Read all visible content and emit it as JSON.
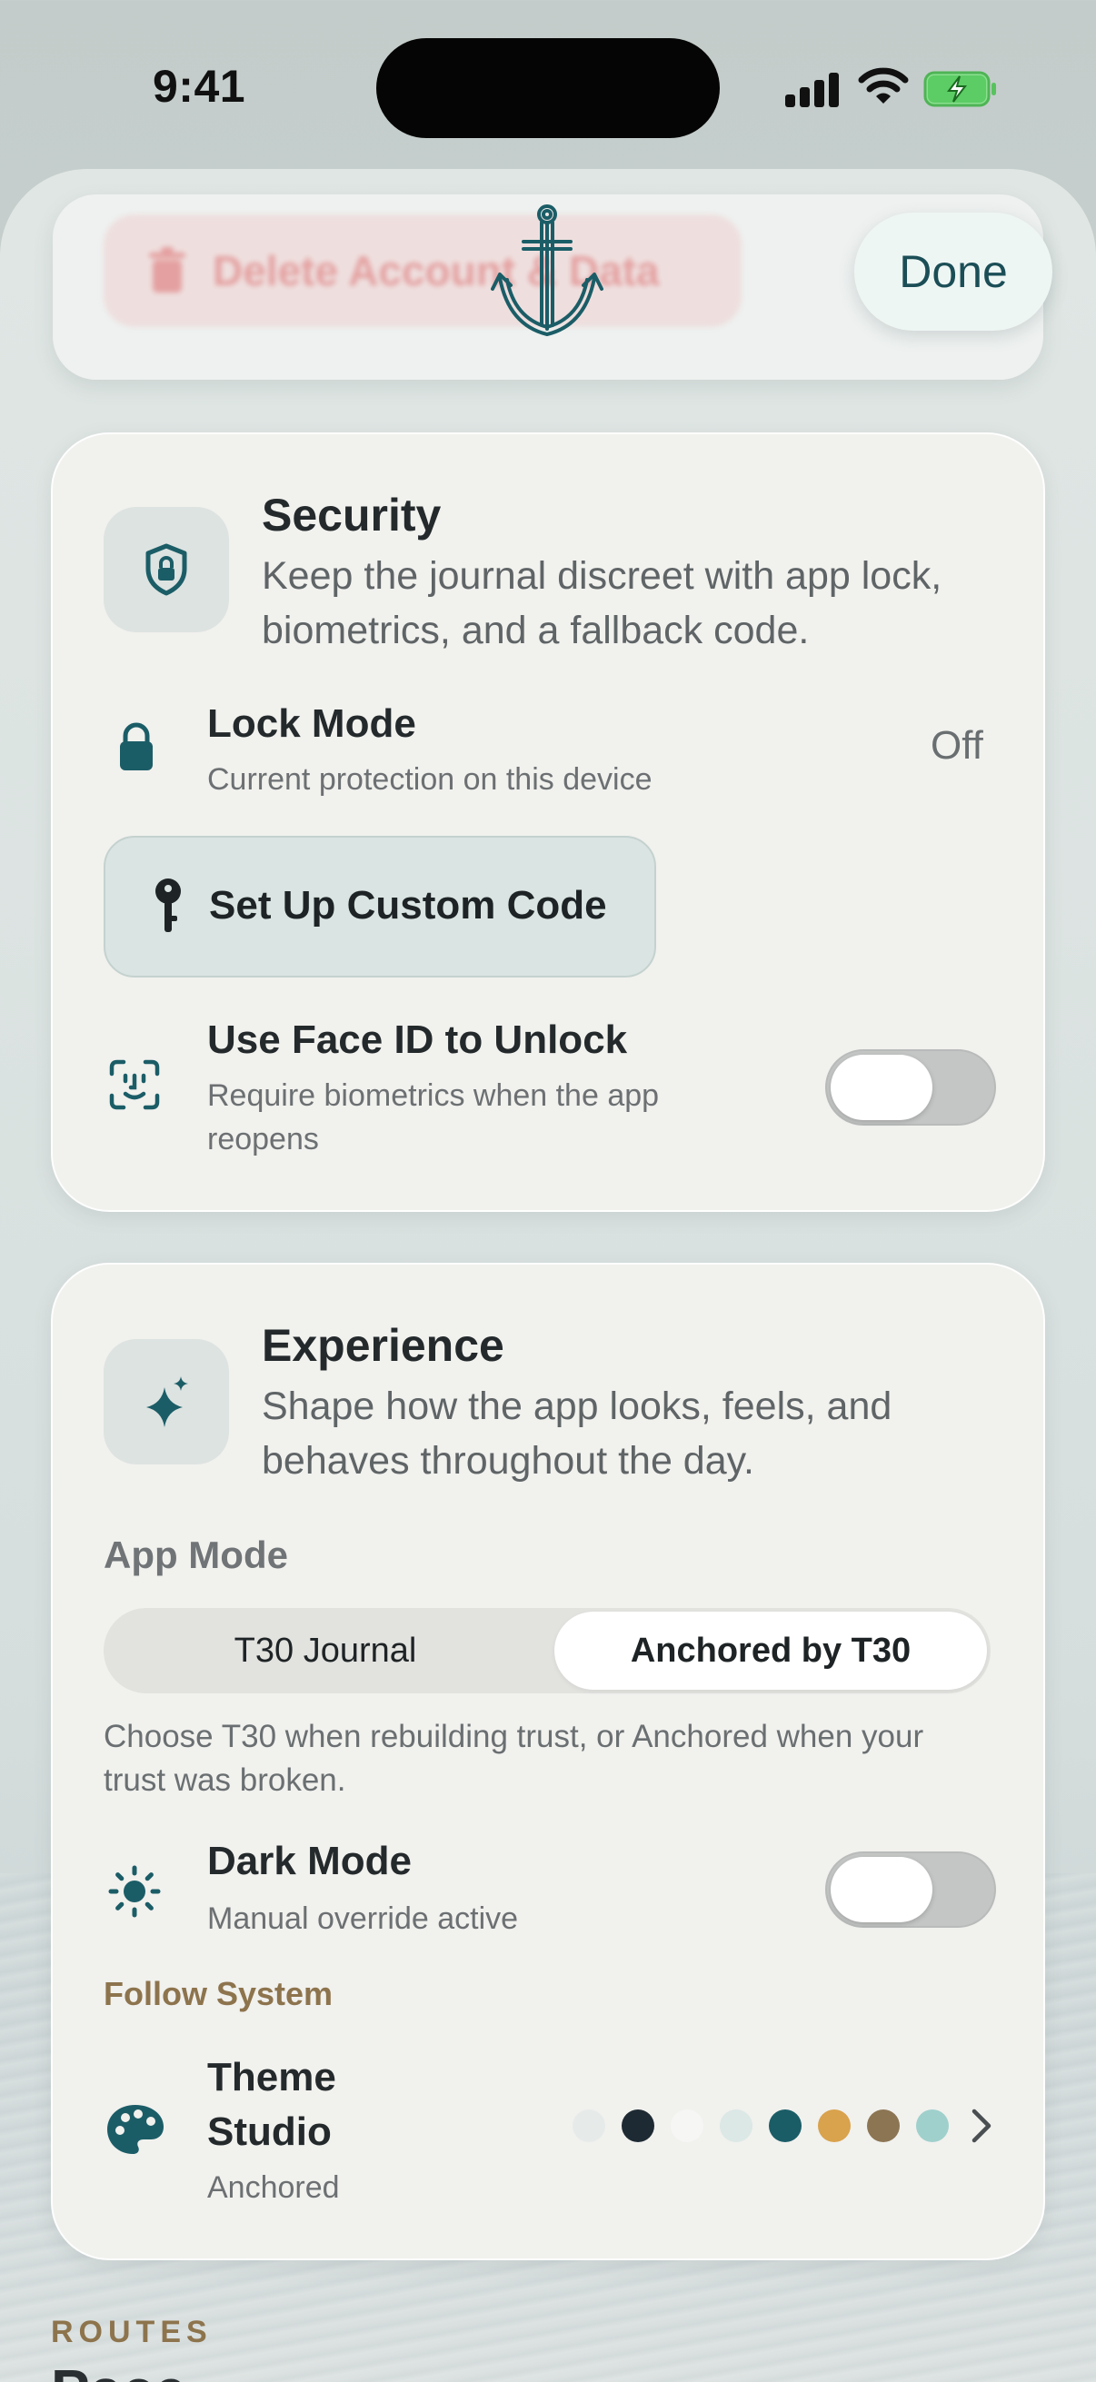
{
  "status_bar": {
    "time": "9:41"
  },
  "header": {
    "behind_button_label": "Delete Account & Data",
    "done_label": "Done"
  },
  "security": {
    "title": "Security",
    "description": "Keep the journal discreet with app lock, biometrics, and a fallback code.",
    "lock_mode": {
      "title": "Lock Mode",
      "subtitle": "Current protection on this device",
      "value": "Off"
    },
    "custom_code_label": "Set Up Custom Code",
    "face_id": {
      "title": "Use Face ID to Unlock",
      "subtitle": "Require biometrics when the app reopens",
      "enabled": false
    }
  },
  "experience": {
    "title": "Experience",
    "description": "Shape how the app looks, feels, and behaves throughout the day.",
    "app_mode_label": "App Mode",
    "app_mode_options": [
      "T30 Journal",
      "Anchored by T30"
    ],
    "app_mode_selected": "Anchored by T30",
    "app_mode_help": "Choose T30 when rebuilding trust, or Anchored when your trust was broken.",
    "dark_mode": {
      "title": "Dark Mode",
      "subtitle": "Manual override active",
      "enabled": false
    },
    "follow_system_label": "Follow System",
    "theme_studio": {
      "title_line1": "Theme",
      "title_line2": "Studio",
      "subtitle": "Anchored",
      "swatches": [
        "#e6ebea",
        "#1e2a33",
        "#f6f7f5",
        "#dbe8e6",
        "#1b5d67",
        "#d9a24c",
        "#8c7553",
        "#9fd0cc"
      ]
    }
  },
  "routes": {
    "label": "ROUTES",
    "next_title": "Pace Settings"
  },
  "colors": {
    "accent": "#1b5d67",
    "gold": "#8d744d",
    "toggle_off": "#c4c6c5"
  }
}
